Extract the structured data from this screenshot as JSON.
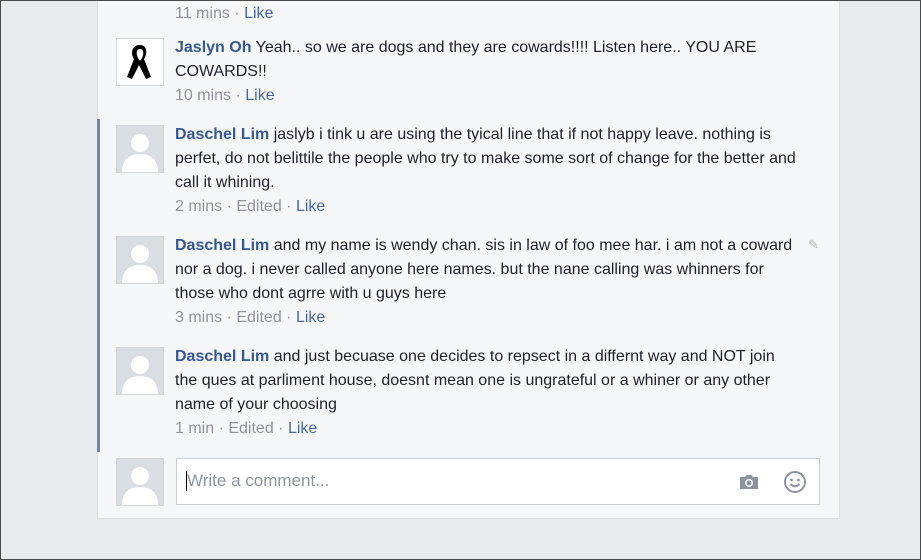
{
  "top_meta": {
    "time": "11 mins",
    "like": "Like"
  },
  "comments": [
    {
      "author": "Jaslyn Oh",
      "text": "Yeah.. so we are dogs and they are cowards!!!! Listen here.. YOU ARE COWARDS!!",
      "time": "10 mins",
      "edited": "",
      "like": "Like",
      "avatar": "black-ribbon-icon"
    },
    {
      "author": "Daschel Lim",
      "text": "jaslyb i tink u are using the tyical line that if not happy leave. nothing is perfet, do not belittile the people who try to make some sort of change for the better and call it whining.",
      "time": "2 mins",
      "edited": "Edited",
      "like": "Like",
      "avatar": "default-avatar-icon"
    },
    {
      "author": "Daschel Lim",
      "text": "and my name is wendy chan. sis in law of foo mee har. i am not a coward nor a dog. i never called anyone here names. but the nane calling was whinners for those who dont agrre with u guys here",
      "time": "3 mins",
      "edited": "Edited",
      "like": "Like",
      "avatar": "default-avatar-icon"
    },
    {
      "author": "Daschel Lim",
      "text": "and just becuase one decides to repsect in a differnt way and NOT join the ques at parliment house, doesnt mean one is ungrateful or a whiner or any other name of your choosing",
      "time": "1 min",
      "edited": "Edited",
      "like": "Like",
      "avatar": "default-avatar-icon"
    }
  ],
  "composer": {
    "placeholder": "Write a comment...",
    "camera_icon": "camera-icon",
    "emoji_icon": "smiley-icon"
  },
  "colors": {
    "author": "#365899",
    "reply_bar": "#6d84c5",
    "meta": "#90949c",
    "background": "#e9eaed"
  }
}
